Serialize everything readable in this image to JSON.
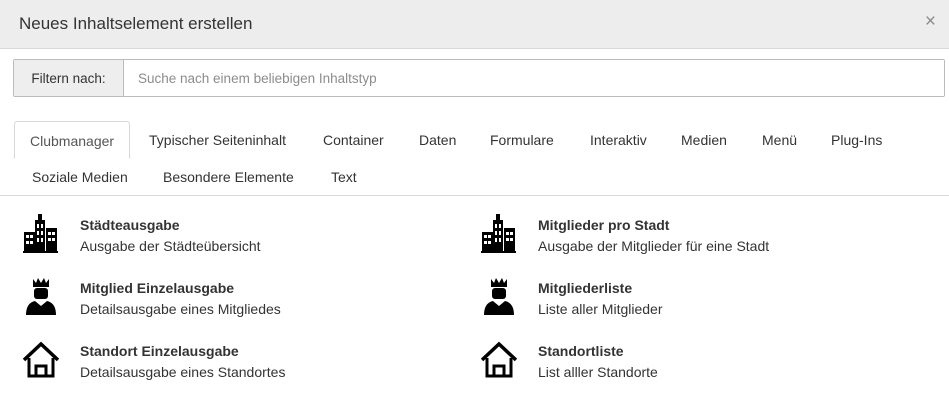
{
  "modal": {
    "title": "Neues Inhaltselement erstellen",
    "close_symbol": "×"
  },
  "filter": {
    "label": "Filtern nach:",
    "placeholder": "Suche nach einem beliebigen Inhaltstyp",
    "value": ""
  },
  "tabs": [
    {
      "label": "Clubmanager",
      "active": true
    },
    {
      "label": "Typischer Seiteninhalt",
      "active": false
    },
    {
      "label": "Container",
      "active": false
    },
    {
      "label": "Daten",
      "active": false
    },
    {
      "label": "Formulare",
      "active": false
    },
    {
      "label": "Interaktiv",
      "active": false
    },
    {
      "label": "Medien",
      "active": false
    },
    {
      "label": "Menü",
      "active": false
    },
    {
      "label": "Plug-Ins",
      "active": false
    },
    {
      "label": "Soziale Medien",
      "active": false
    },
    {
      "label": "Besondere Elemente",
      "active": false
    },
    {
      "label": "Text",
      "active": false
    }
  ],
  "elements": [
    {
      "title": "Städteausgabe",
      "description": "Ausgabe der Städteübersicht",
      "icon": "city-buildings-icon"
    },
    {
      "title": "Mitglieder pro Stadt",
      "description": "Ausgabe der Mitglieder für eine Stadt",
      "icon": "city-buildings-icon"
    },
    {
      "title": "Mitglied Einzelausgabe",
      "description": "Detailsausgabe eines Mitgliedes",
      "icon": "crowned-person-icon"
    },
    {
      "title": "Mitgliederliste",
      "description": "Liste aller Mitglieder",
      "icon": "crowned-person-icon"
    },
    {
      "title": "Standort Einzelausgabe",
      "description": "Detailsausgabe eines Standortes",
      "icon": "house-icon"
    },
    {
      "title": "Standortliste",
      "description": "List alller Standorte",
      "icon": "house-icon"
    }
  ],
  "colors": {
    "header_bg": "#ededed",
    "border": "#d7d7d7",
    "text": "#333333",
    "icon": "#000000"
  }
}
